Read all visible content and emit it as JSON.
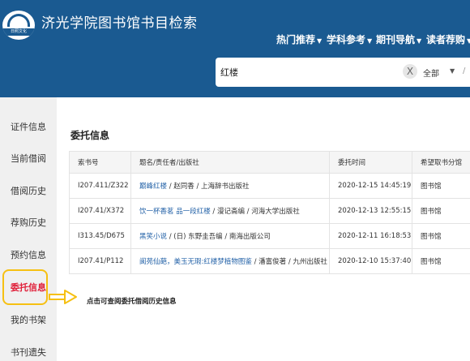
{
  "header": {
    "logo_text": "日照文化",
    "site_title": "济光学院图书馆书目检索",
    "nav": [
      {
        "label": "热门推荐"
      },
      {
        "label": "学科参考"
      },
      {
        "label": "期刊导航"
      },
      {
        "label": "读者荐购"
      }
    ]
  },
  "search": {
    "value": "红楼",
    "clear_symbol": "X",
    "scope": "全部",
    "separator": "/"
  },
  "sidebar": {
    "items": [
      {
        "label": "证件信息"
      },
      {
        "label": "当前借阅"
      },
      {
        "label": "借阅历史"
      },
      {
        "label": "荐购历史"
      },
      {
        "label": "预约信息"
      },
      {
        "label": "委托信息"
      },
      {
        "label": "我的书架"
      },
      {
        "label": "书刊遗失"
      }
    ],
    "active_index": 5
  },
  "main": {
    "title": "委托信息",
    "columns": [
      "索书号",
      "题名/责任者/出版社",
      "委托时间",
      "希望取书分馆"
    ],
    "rows": [
      {
        "call_no": "I207.411/Z322",
        "title": "巅峰红楼",
        "meta": " / 赵同香 / 上海辞书出版社",
        "time": "2020-12-15 14:45:19",
        "branch": "图书馆"
      },
      {
        "call_no": "I207.41/X372",
        "title": "饮一杯香茗 品一段红楼",
        "meta": " / 漫记斋编 / 河海大学出版社",
        "time": "2020-12-13 12:55:15",
        "branch": "图书馆"
      },
      {
        "call_no": "I313.45/D675",
        "title": "黑笑小说",
        "meta": " / (日) 东野圭吾编 / 南海出版公司",
        "time": "2020-12-11 16:18:53",
        "branch": "图书馆"
      },
      {
        "call_no": "I207.41/P112",
        "title": "阆苑仙葩，美玉无瑕:红楼梦植物图鉴",
        "meta": " / 潘富俊著 / 九州出版社",
        "time": "2020-12-10 15:37:40",
        "branch": "图书馆"
      }
    ],
    "history_hint": "点击可查阅委托借阅历史信息"
  },
  "colors": {
    "header_bg": "#1a5a91",
    "active_red": "#e0203a",
    "highlight": "#f6c012",
    "link": "#2563a8"
  }
}
